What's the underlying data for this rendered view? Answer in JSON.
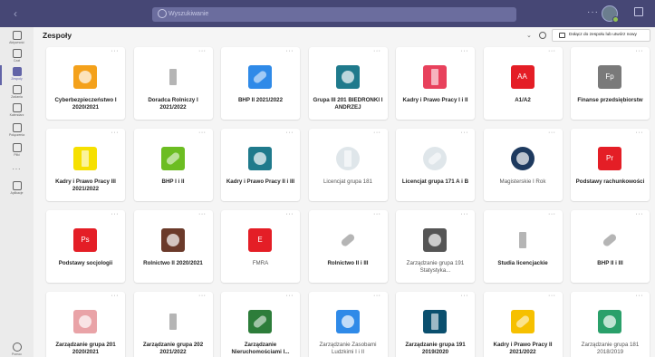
{
  "titlebar": {
    "search_placeholder": "Wyszukiwanie",
    "window_colors": {
      "bar": "#464775",
      "accent": "#6264a7"
    }
  },
  "rail": {
    "items": [
      {
        "label": "Aktywność",
        "icon": "bell-icon",
        "active": false
      },
      {
        "label": "Czat",
        "icon": "chat-icon",
        "active": false
      },
      {
        "label": "Zespoły",
        "icon": "teams-icon",
        "active": true
      },
      {
        "label": "Zadania",
        "icon": "assignments-icon",
        "active": false
      },
      {
        "label": "Kalendarz",
        "icon": "calendar-icon",
        "active": false
      },
      {
        "label": "Połączenia",
        "icon": "phone-icon",
        "active": false
      },
      {
        "label": "Pliki",
        "icon": "files-icon",
        "active": false
      }
    ],
    "more": "...",
    "apps": {
      "label": "Aplikacje",
      "icon": "apps-icon"
    },
    "help": {
      "label": "Pomoc",
      "icon": "help-icon"
    }
  },
  "header": {
    "title": "Zespoły",
    "join_label": "Dołącz do zespołu lub utwórz nowy"
  },
  "teams": [
    {
      "name": "Cyberbezpieczeństwo I 2020/2021",
      "logo": "gears-icon",
      "color": "#f4a11b",
      "bold": true
    },
    {
      "name": "Doradca Rolniczy I 2021/2022",
      "logo": "market-stall-icon",
      "color": "#ffffff",
      "bold": true
    },
    {
      "name": "BHP II 2021/2022",
      "logo": "bandage-icon",
      "color": "#2f8ae8",
      "bold": true
    },
    {
      "name": "Grupa III 201 BIEDRONKI I ANDRZEJ",
      "logo": "microscope-icon",
      "color": "#1f7a8c",
      "bold": true
    },
    {
      "name": "Kadry i Prawo Pracy I i II",
      "logo": "gavel-icon",
      "color": "#e8415c",
      "bold": true
    },
    {
      "name": "A1/A2",
      "abbr": "AA",
      "color": "#e41e26",
      "bold": true
    },
    {
      "name": "Finanse przedsiębiorstw",
      "abbr": "Fp",
      "color": "#7a7a7a",
      "bold": true
    },
    {
      "name": "Kadry i Prawo Pracy III 2021/2022",
      "logo": "ballot-box-icon",
      "color": "#f6e000",
      "bold": true
    },
    {
      "name": "BHP I i II",
      "logo": "battery-icon",
      "color": "#6cbd22",
      "bold": true
    },
    {
      "name": "Kadry i Prawo Pracy II i III",
      "logo": "microscope-icon",
      "color": "#1f7a8c",
      "bold": true
    },
    {
      "name": "Licencjat grupa 181",
      "logo": "university-seal-icon",
      "color": "#dfe6ea",
      "bold": false
    },
    {
      "name": "Licencjat grupa 171 A i B",
      "logo": "university-seal-icon",
      "color": "#dfe6ea",
      "bold": true
    },
    {
      "name": "Magisterskie I Rok",
      "logo": "university-seal-icon",
      "color": "#1e3a5f",
      "bold": false
    },
    {
      "name": "Podstawy rachunkowości",
      "abbr": "Pr",
      "color": "#e41e26",
      "bold": true
    },
    {
      "name": "Podstawy socjologii",
      "abbr": "Ps",
      "color": "#e41e26",
      "bold": true
    },
    {
      "name": "Rolnictwo II 2020/2021",
      "logo": "tools-icon",
      "color": "#6b3a2a",
      "bold": true
    },
    {
      "name": "FMRA",
      "abbr": "E",
      "color": "#e41e26",
      "bold": false
    },
    {
      "name": "Rolnictwo II i III",
      "logo": "deer-icon",
      "color": "#ffffff",
      "bold": true
    },
    {
      "name": "Zarządzanie grupa 191 Statystyka...",
      "logo": "photo-icon",
      "color": "#555555",
      "bold": false
    },
    {
      "name": "Studia licencjackie",
      "logo": "university-seal-icon",
      "color": "#ffffff",
      "bold": true
    },
    {
      "name": "BHP II i III",
      "logo": "wrench-screwdriver-icon",
      "color": "#ffffff",
      "bold": true
    },
    {
      "name": "Zarządzanie grupa 201 2020/2021",
      "logo": "column-icon",
      "color": "#e9a3a7",
      "bold": true
    },
    {
      "name": "Zarządzanie grupa 202 2021/2022",
      "logo": "desk-icon",
      "color": "#ffffff",
      "bold": true
    },
    {
      "name": "Zarządzanie Nieruchomościami I...",
      "logo": "camp-tent-icon",
      "color": "#2d7d3a",
      "bold": true
    },
    {
      "name": "Zarządzanie Zasobami Ludzkimi I i II",
      "logo": "scroll-icon",
      "color": "#2f8ae8",
      "bold": false
    },
    {
      "name": "Zarządzanie grupa 191 2019/2020",
      "logo": "globe-icon",
      "color": "#0a4f6e",
      "bold": true
    },
    {
      "name": "Kadry i Prawo Pracy II 2021/2022",
      "logo": "books-icon",
      "color": "#f6c000",
      "bold": true
    },
    {
      "name": "Zarządzanie grupa 181 2018/2019",
      "logo": "globe-grid-icon",
      "color": "#2aa06a",
      "bold": false
    }
  ]
}
